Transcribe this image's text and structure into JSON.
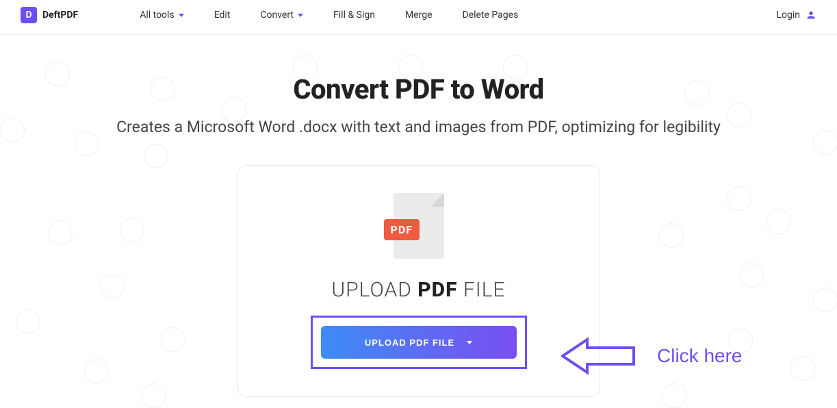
{
  "brand": {
    "letter": "D",
    "name": "DeftPDF"
  },
  "nav": {
    "all_tools": "All tools",
    "edit": "Edit",
    "convert": "Convert",
    "fill_sign": "Fill & Sign",
    "merge": "Merge",
    "delete_pages": "Delete Pages"
  },
  "login": "Login",
  "hero": {
    "title": "Convert PDF to Word",
    "subtitle": "Creates a Microsoft Word .docx with text and images from PDF, optimizing for legibility"
  },
  "upload": {
    "badge": "PDF",
    "label_pre": "UPLOAD ",
    "label_bold": "PDF",
    "label_post": " FILE",
    "button": "UPLOAD PDF FILE"
  },
  "annotation": {
    "text": "Click here"
  }
}
